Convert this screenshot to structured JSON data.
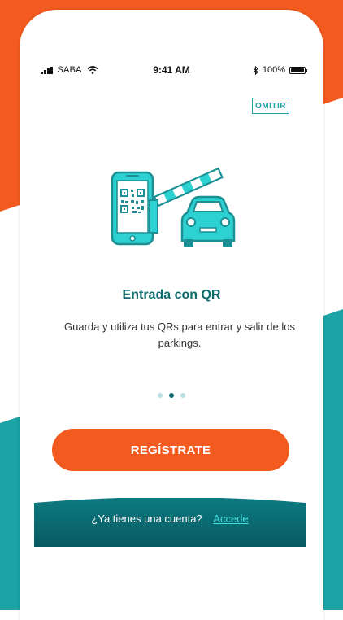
{
  "colors": {
    "brand_orange": "#f25a1f",
    "brand_teal": "#1ba3a5",
    "dark_teal": "#0f6d70",
    "footer_bg": "#0a5f66"
  },
  "status_bar": {
    "carrier": "SABA",
    "time": "9:41 AM",
    "battery_text": "100%",
    "icons": [
      "signal-icon",
      "wifi-icon",
      "bluetooth-icon",
      "battery-icon"
    ]
  },
  "onboarding": {
    "skip_label": "OMITIR",
    "title": "Entrada con QR",
    "description": "Guarda y utiliza tus QRs para entrar y salir de los parkings.",
    "illustration": "qr-phone-barrier-car-icon",
    "page_dots": {
      "count": 3,
      "active_index": 1
    }
  },
  "register_button": {
    "label": "REGÍSTRATE"
  },
  "footer": {
    "question": "¿Ya tienes una cuenta?",
    "link_label": "Accede"
  }
}
